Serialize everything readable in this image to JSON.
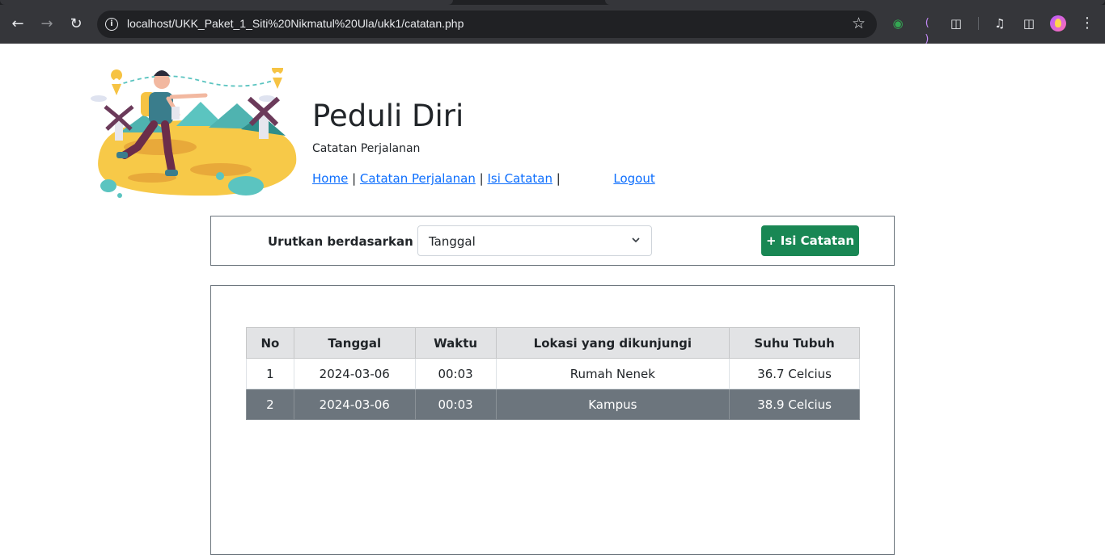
{
  "browser": {
    "url": "localhost/UKK_Paket_1_Siti%20Nikmatul%20Ula/ukk1/catatan.php"
  },
  "header": {
    "title": "Peduli Diri",
    "subtitle": "Catatan Perjalanan",
    "nav": {
      "home": "Home",
      "sep1": "|",
      "catatan": "Catatan Perjalanan",
      "sep2": "|",
      "isi": "Isi Catatan",
      "sep3": "|",
      "logout": "Logout"
    }
  },
  "sort": {
    "label": "Urutkan berdasarkan",
    "selected": "Tanggal",
    "add_button": "+ Isi Catatan"
  },
  "table": {
    "headers": [
      "No",
      "Tanggal",
      "Waktu",
      "Lokasi yang dikunjungi",
      "Suhu Tubuh"
    ],
    "rows": [
      [
        "1",
        "2024-03-06",
        "00:03",
        "Rumah Nenek",
        "36.7 Celcius"
      ],
      [
        "2",
        "2024-03-06",
        "00:03",
        "Kampus",
        "38.9 Celcius"
      ]
    ]
  },
  "colors": {
    "primary_link": "#0d6efd",
    "success": "#198754",
    "secondary": "#6c757d"
  }
}
